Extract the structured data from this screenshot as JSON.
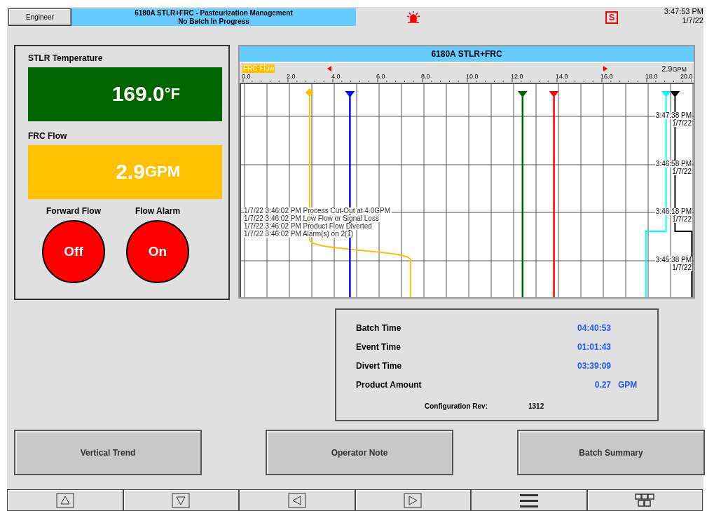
{
  "header": {
    "user_button": "Engineer",
    "title": "6180A STLR+FRC - Pasteurization Management",
    "subtitle": "No Batch In Progress",
    "alarm_active": true,
    "badge": "S",
    "time": "3:47:53 PM",
    "date": "1/7/22"
  },
  "readings": [
    {
      "label": "STLR Temperature",
      "value": "169.0",
      "unit": "°F",
      "color": "#006400"
    },
    {
      "label": "FRC Flow",
      "value": "2.9",
      "unit": "GPM",
      "color": "#ffc000"
    }
  ],
  "indicators": [
    {
      "label": "Forward Flow",
      "state": "Off"
    },
    {
      "label": "Flow Alarm",
      "state": "On"
    }
  ],
  "trend": {
    "title": "6180A STLR+FRC",
    "pen_label": "FRC Flow",
    "current": "2.9",
    "current_unit": "GPM",
    "scale": [
      "0.0",
      "2.0",
      "4.0",
      "6.0",
      "8.0",
      "10.0",
      "12.0",
      "14.0",
      "16.0",
      "18.0",
      "20.0"
    ],
    "time_marks": [
      {
        "time": "3:47:38 PM",
        "date": "1/7/22"
      },
      {
        "time": "3:46:58 PM",
        "date": "1/7/22"
      },
      {
        "time": "3:46:18 PM",
        "date": "1/7/22"
      },
      {
        "time": "3:45:38 PM",
        "date": "1/7/22"
      }
    ],
    "events": [
      "1/7/22 3:46:02 PM Process Cut-Out at 4.0GPM",
      "1/7/22 3:46:02 PM Low Flow or Signal Loss",
      "1/7/22 3:46:02 PM Product Flow Diverted",
      "1/7/22 3:46:02 PM Alarm(s) on 2(1)"
    ]
  },
  "summary": {
    "rows": [
      {
        "label": "Batch Time",
        "value": "04:40:53"
      },
      {
        "label": "Event Time",
        "value": "01:01:43"
      },
      {
        "label": "Divert Time",
        "value": "03:39:09"
      },
      {
        "label": "Product Amount",
        "value": "0.27",
        "unit": "GPM"
      }
    ],
    "config_label": "Configuration Rev:",
    "config_value": "1312"
  },
  "actions": [
    "Vertical Trend",
    "Operator Note",
    "Batch Summary"
  ],
  "nav": [
    {
      "kind": "up"
    },
    {
      "kind": "down"
    },
    {
      "kind": "left"
    },
    {
      "kind": "right"
    },
    {
      "kind": "menu"
    },
    {
      "kind": "grid"
    }
  ]
}
